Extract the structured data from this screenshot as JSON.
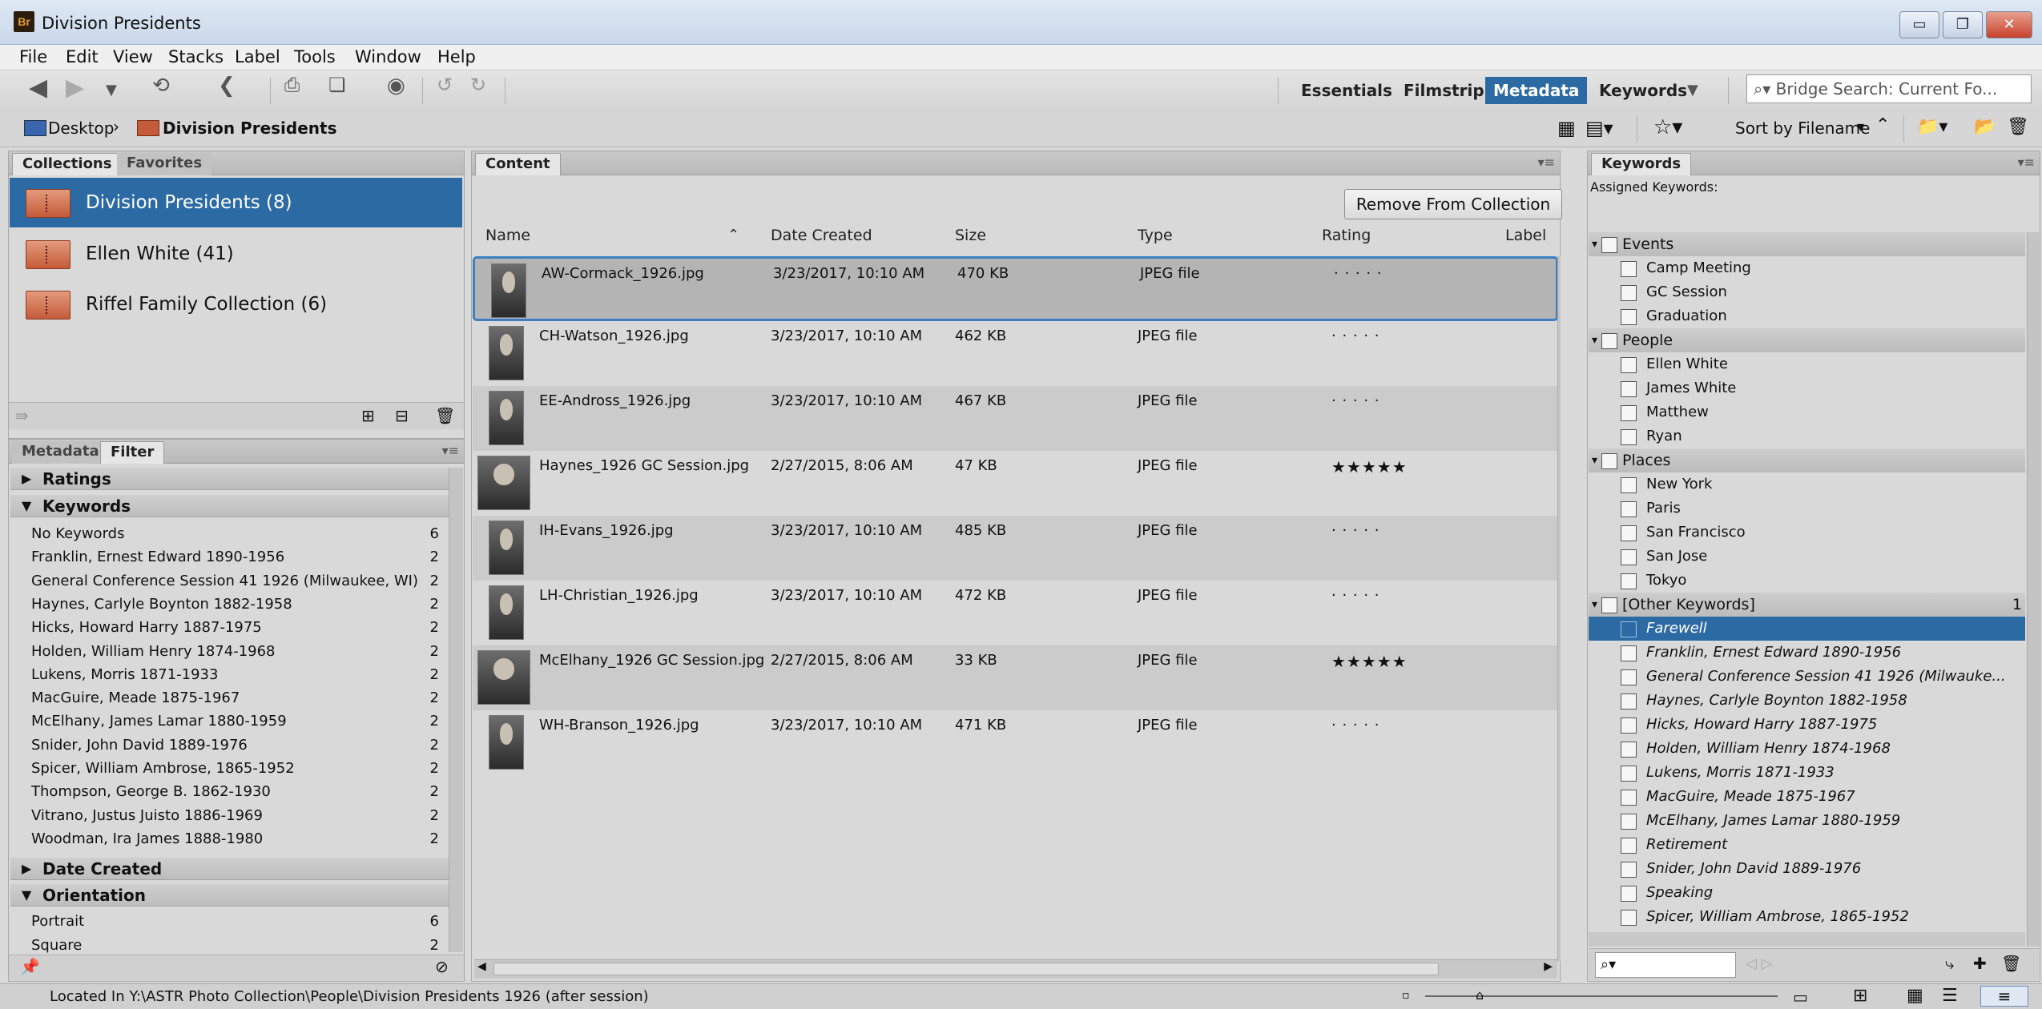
{
  "window": {
    "title": "Division Presidents",
    "logo": "Br"
  },
  "menu": [
    "File",
    "Edit",
    "View",
    "Stacks",
    "Label",
    "Tools",
    "Window",
    "Help"
  ],
  "workspaces": {
    "essentials": "Essentials",
    "filmstrip": "Filmstrip",
    "metadata": "Metadata",
    "keywords": "Keywords"
  },
  "search": {
    "placeholder": "Bridge Search: Current Fo..."
  },
  "breadcrumb": {
    "root": "Desktop",
    "current": "Division Presidents"
  },
  "sort": {
    "label": "Sort by Filename"
  },
  "collections_panel": {
    "tabs": [
      "Collections",
      "Favorites"
    ],
    "items": [
      "Division Presidents (8)",
      "Ellen White (41)",
      "Riffel Family Collection (6)"
    ]
  },
  "filter_panel": {
    "tabs": [
      "Metadata",
      "Filter"
    ],
    "groups": {
      "ratings": "Ratings",
      "keywords": "Keywords",
      "date_created": "Date Created",
      "orientation": "Orientation"
    },
    "keywords": [
      {
        "label": "No Keywords",
        "count": "6"
      },
      {
        "label": "Franklin, Ernest Edward 1890-1956",
        "count": "2"
      },
      {
        "label": "General Conference Session 41 1926 (Milwaukee, WI)",
        "count": "2"
      },
      {
        "label": "Haynes, Carlyle Boynton 1882-1958",
        "count": "2"
      },
      {
        "label": "Hicks, Howard Harry 1887-1975",
        "count": "2"
      },
      {
        "label": "Holden, William Henry 1874-1968",
        "count": "2"
      },
      {
        "label": "Lukens, Morris 1871-1933",
        "count": "2"
      },
      {
        "label": "MacGuire, Meade 1875-1967",
        "count": "2"
      },
      {
        "label": "McElhany, James Lamar 1880-1959",
        "count": "2"
      },
      {
        "label": "Snider, John David 1889-1976",
        "count": "2"
      },
      {
        "label": "Spicer, William Ambrose, 1865-1952",
        "count": "2"
      },
      {
        "label": "Thompson, George B. 1862-1930",
        "count": "2"
      },
      {
        "label": "Vitrano, Justus Juisto 1886-1969",
        "count": "2"
      },
      {
        "label": "Woodman, Ira James 1888-1980",
        "count": "2"
      }
    ],
    "orientation": [
      {
        "label": "Portrait",
        "count": "6"
      },
      {
        "label": "Square",
        "count": "2"
      }
    ]
  },
  "content_panel": {
    "tab": "Content",
    "remove_button": "Remove From Collection",
    "columns": {
      "name": "Name",
      "date": "Date Created",
      "size": "Size",
      "type": "Type",
      "rating": "Rating",
      "label": "Label"
    },
    "rows": [
      {
        "name": "AW-Cormack_1926.jpg",
        "date": "3/23/2017, 10:10 AM",
        "size": "470 KB",
        "type": "JPEG file",
        "rating": "· · · · ·"
      },
      {
        "name": "CH-Watson_1926.jpg",
        "date": "3/23/2017, 10:10 AM",
        "size": "462 KB",
        "type": "JPEG file",
        "rating": "· · · · ·"
      },
      {
        "name": "EE-Andross_1926.jpg",
        "date": "3/23/2017, 10:10 AM",
        "size": "467 KB",
        "type": "JPEG file",
        "rating": "· · · · ·"
      },
      {
        "name": "Haynes_1926 GC Session.jpg",
        "date": "2/27/2015, 8:06 AM",
        "size": "47 KB",
        "type": "JPEG file",
        "rating": "★★★★★"
      },
      {
        "name": "IH-Evans_1926.jpg",
        "date": "3/23/2017, 10:10 AM",
        "size": "485 KB",
        "type": "JPEG file",
        "rating": "· · · · ·"
      },
      {
        "name": "LH-Christian_1926.jpg",
        "date": "3/23/2017, 10:10 AM",
        "size": "472 KB",
        "type": "JPEG file",
        "rating": "· · · · ·"
      },
      {
        "name": "McElhany_1926 GC Session.jpg",
        "date": "2/27/2015, 8:06 AM",
        "size": "33 KB",
        "type": "JPEG file",
        "rating": "★★★★★"
      },
      {
        "name": "WH-Branson_1926.jpg",
        "date": "3/23/2017, 10:10 AM",
        "size": "471 KB",
        "type": "JPEG file",
        "rating": "· · · · ·"
      }
    ]
  },
  "keywords_panel": {
    "tab": "Keywords",
    "assigned_label": "Assigned Keywords:",
    "groups": [
      {
        "name": "Events",
        "items": [
          "Camp Meeting",
          "GC Session",
          "Graduation"
        ]
      },
      {
        "name": "People",
        "items": [
          "Ellen White",
          "James White",
          "Matthew",
          "Ryan"
        ]
      },
      {
        "name": "Places",
        "items": [
          "New York",
          "Paris",
          "San Francisco",
          "San Jose",
          "Tokyo"
        ]
      },
      {
        "name": "[Other Keywords]",
        "count": "1",
        "items": [
          "Farewell",
          "Franklin, Ernest Edward 1890-1956",
          "General Conference Session 41 1926 (Milwauke...",
          "Haynes, Carlyle Boynton 1882-1958",
          "Hicks, Howard Harry 1887-1975",
          "Holden, William Henry 1874-1968",
          "Lukens, Morris 1871-1933",
          "MacGuire, Meade 1875-1967",
          "McElhany, James Lamar 1880-1959",
          "Retirement",
          "Snider, John David 1889-1976",
          "Speaking",
          "Spicer, William Ambrose, 1865-1952"
        ]
      }
    ]
  },
  "status": {
    "path": "Located In Y:\\ASTR Photo Collection\\People\\Division Presidents 1926 (after session)"
  },
  "colors": {
    "accent": "#2c6aa4",
    "panel_bg": "#d9d9d9"
  }
}
